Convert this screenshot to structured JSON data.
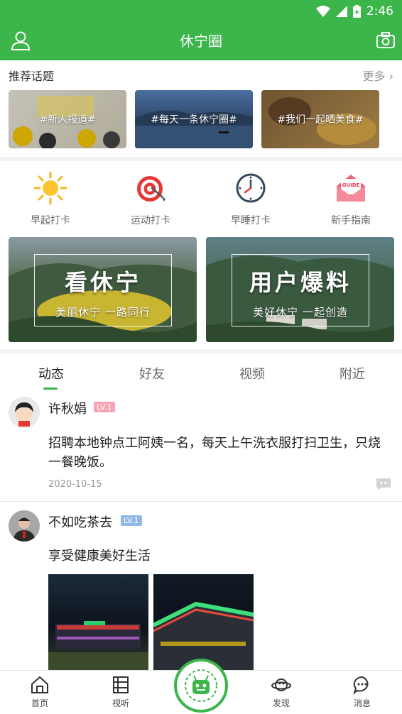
{
  "status": {
    "time": "2:46"
  },
  "header": {
    "title": "休宁圈"
  },
  "recommend": {
    "title": "推荐话题",
    "more": "更多"
  },
  "topics": [
    {
      "label": "#新人报道#"
    },
    {
      "label": "#每天一条休宁圈#"
    },
    {
      "label": "#我们一起晒美食#"
    }
  ],
  "quick": [
    {
      "label": "早起打卡",
      "icon": "sun-icon"
    },
    {
      "label": "运动打卡",
      "icon": "target-icon"
    },
    {
      "label": "早睡打卡",
      "icon": "clock-icon"
    },
    {
      "label": "新手指南",
      "icon": "guide-envelope-icon",
      "badge": "GUIDE"
    }
  ],
  "banners": [
    {
      "title": "看休宁",
      "subtitle": "美丽休宁 一路同行"
    },
    {
      "title": "用户爆料",
      "subtitle": "美好休宁 一起创造"
    }
  ],
  "tabs": [
    "动态",
    "好友",
    "视频",
    "附近"
  ],
  "posts": [
    {
      "user": "许秋娟",
      "level": "LV.1",
      "text": "招聘本地钟点工阿姨一名，每天上午洗衣服打扫卫生，只烧一餐晚饭。",
      "date": "2020-10-15"
    },
    {
      "user": "不如吃茶去",
      "level": "LV.1",
      "text": "享受健康美好生活"
    }
  ],
  "nav": [
    {
      "label": "首页"
    },
    {
      "label": "视听"
    },
    {
      "label": "发现"
    },
    {
      "label": "消息"
    }
  ],
  "colors": {
    "primary": "#3cb54a",
    "lv_pink": "#f7a4b4",
    "lv_blue": "#8fb9ea"
  }
}
